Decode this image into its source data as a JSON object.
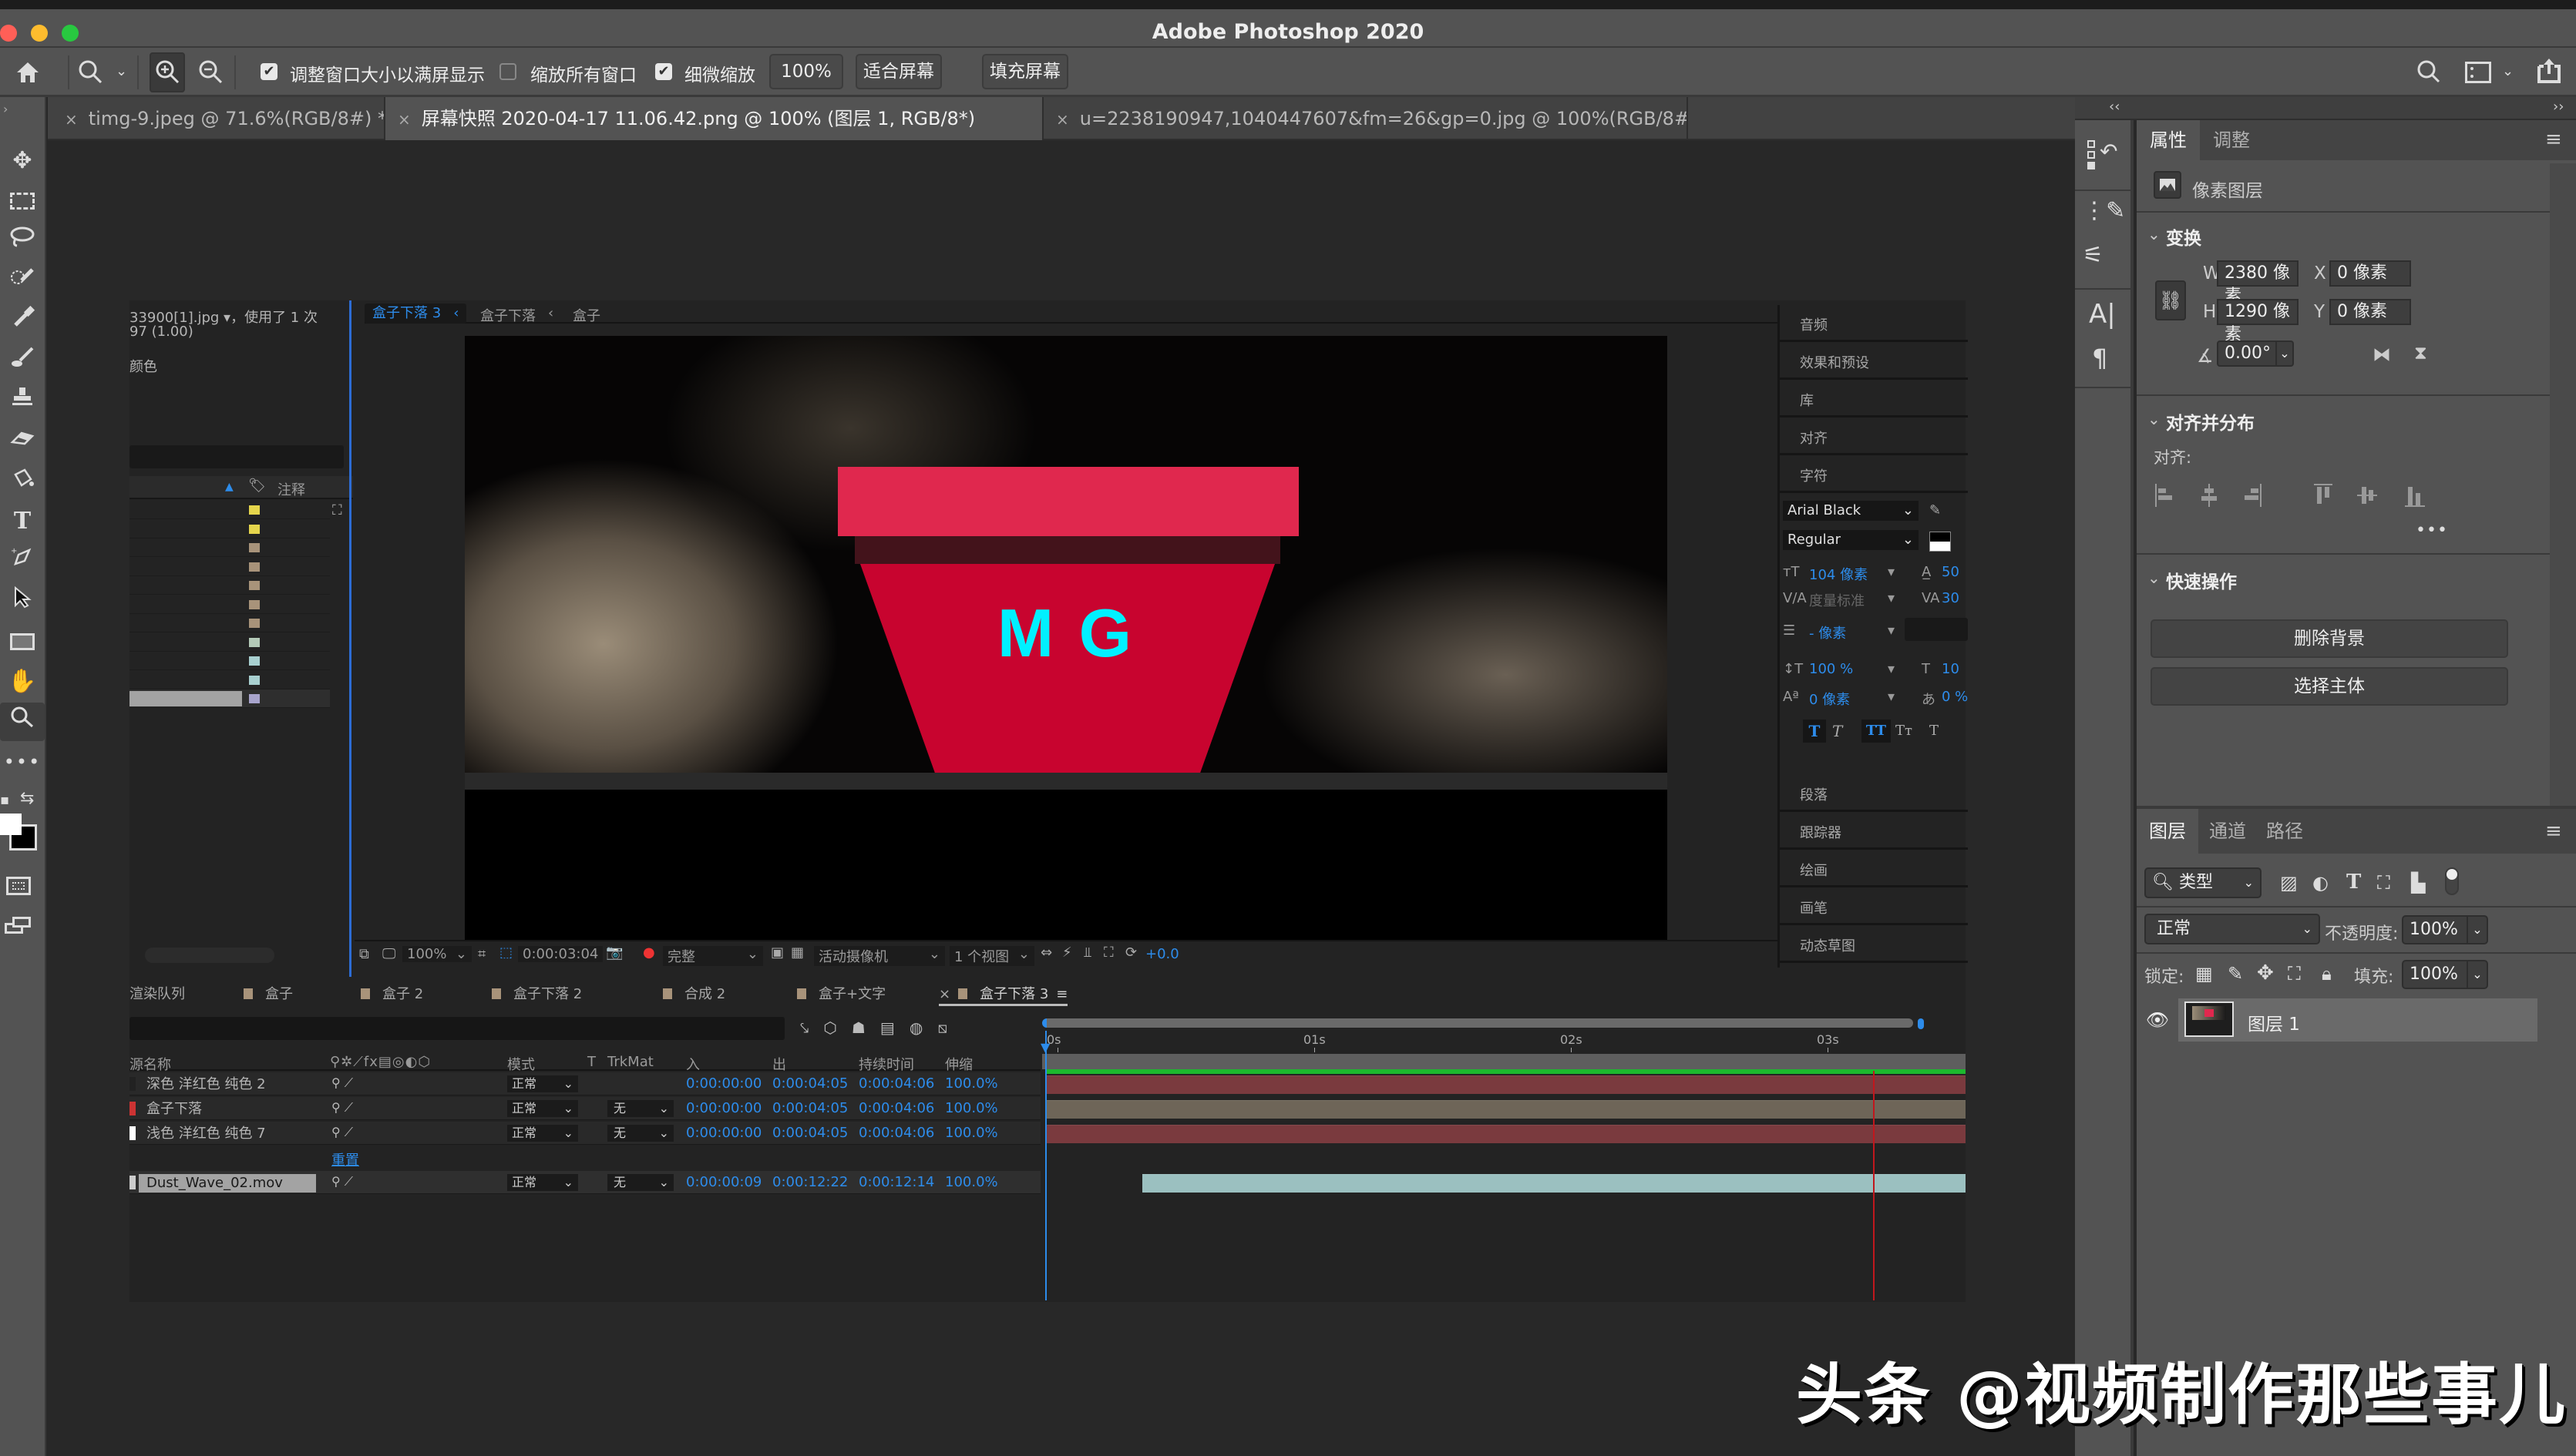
{
  "window": {
    "title": "Adobe Photoshop 2020",
    "traffic_lights": {
      "close": "#ff5f57",
      "minimize": "#febc2e",
      "zoom": "#28c840"
    }
  },
  "options_bar": {
    "home_icon": "home-icon",
    "zoom_tool_icon": "zoom-icon",
    "zoom_in_icon": "zoom-in-icon",
    "zoom_out_icon": "zoom-out-icon",
    "resize_windows_label": "调整窗口大小以满屏显示",
    "resize_windows_checked": true,
    "zoom_all_windows_label": "缩放所有窗口",
    "zoom_all_windows_checked": false,
    "scrubby_zoom_label": "细微缩放",
    "scrubby_zoom_checked": true,
    "zoom_value": "100%",
    "fit_screen_label": "适合屏幕",
    "fill_screen_label": "填充屏幕"
  },
  "document_tabs": [
    {
      "label": "timg-9.jpeg @ 71.6%(RGB/8#) *",
      "active": false
    },
    {
      "label": "屏幕快照 2020-04-17 11.06.42.png @ 100% (图层 1, RGB/8*)",
      "active": true
    },
    {
      "label": "u=2238190947,1040447607&fm=26&gp=0.jpg @ 100%(RGB/8#)",
      "active": false
    }
  ],
  "tools": [
    "move-tool",
    "marquee-tool",
    "lasso-tool",
    "quick-selection-tool",
    "eyedropper-tool",
    "brush-tool",
    "stamp-tool",
    "eraser-tool",
    "paint-bucket-tool",
    "type-tool",
    "pen-tool",
    "path-selection-tool",
    "rectangle-tool",
    "hand-tool",
    "zoom-tool",
    "more-tools"
  ],
  "ae_screenshot": {
    "project_info_line1": "33900[1].jpg ▾，使用了 1 次",
    "project_info_line2": "97 (1.00)",
    "project_info_line3": "颜色",
    "project_column_comment": "注释",
    "project_label_colors": [
      "#e5d54c",
      "#e5d54c",
      "#a8937a",
      "#a8937a",
      "#a8937a",
      "#a8937a",
      "#a8937a",
      "#b4cab8",
      "#a8d0d0",
      "#a8d0d0",
      "#a8a4cc"
    ],
    "breadcrumb": [
      {
        "label": "盒子下落 3",
        "active": true
      },
      {
        "label": "盒子下落",
        "active": false
      },
      {
        "label": "盒子",
        "active": false
      }
    ],
    "comp_text": "M G",
    "comp_colors": {
      "box_lid": "#e0284e",
      "box_shadow": "#43131b",
      "box_body": "#c8042f",
      "text": "#00f0ff"
    },
    "viewer_bar": {
      "zoom": "100%",
      "timecode": "0:00:03:04",
      "resolution": "完整",
      "camera": "活动摄像机",
      "views": "1 个视图",
      "exposure": "+0.0"
    },
    "right_panels_top": [
      "音频",
      "效果和预设",
      "库",
      "对齐",
      "字符"
    ],
    "character": {
      "font": "Arial Black",
      "style": "Regular",
      "size": "104 像素",
      "leading": "50",
      "kerning": "度量标准",
      "tracking": "30",
      "stroke": "- 像素",
      "vscale": "100 %",
      "hscale": "10",
      "baseline": "0 像素",
      "tsume": "0 %"
    },
    "right_panels_bottom": [
      "段落",
      "跟踪器",
      "绘画",
      "画笔",
      "动态草图"
    ],
    "timeline_tabs": [
      {
        "label": "渲染队列",
        "color": null
      },
      {
        "label": "盒子",
        "color": "#a8937a"
      },
      {
        "label": "盒子 2",
        "color": "#a8937a"
      },
      {
        "label": "盒子下落 2",
        "color": "#a8937a"
      },
      {
        "label": "合成 2",
        "color": "#a8937a"
      },
      {
        "label": "盒子+文字",
        "color": "#a8937a"
      },
      {
        "label": "盒子下落 3",
        "color": "#a8937a",
        "active": true
      }
    ],
    "layer_columns": [
      "源名称",
      "模式",
      "T",
      "TrkMat",
      "入",
      "出",
      "持续时间",
      "伸缩"
    ],
    "layers": [
      {
        "name": "深色 洋红色 纯色 2",
        "mode": "正常",
        "trkmat": "",
        "in": "0:00:00:00",
        "out": "0:00:04:05",
        "duration": "0:00:04:06",
        "stretch": "100.0%",
        "bar_color": "#7a3a3e",
        "swatch": "#222"
      },
      {
        "name": "盒子下落",
        "mode": "正常",
        "trkmat": "无",
        "in": "0:00:00:00",
        "out": "0:00:04:05",
        "duration": "0:00:04:06",
        "stretch": "100.0%",
        "bar_color": "#6e6558",
        "swatch": "#c33"
      },
      {
        "name": "浅色 洋红色 纯色 7",
        "mode": "正常",
        "trkmat": "无",
        "in": "0:00:00:00",
        "out": "0:00:04:05",
        "duration": "0:00:04:06",
        "stretch": "100.0%",
        "bar_color": "#7a3a3e",
        "swatch": "#fff"
      },
      {
        "name": "Dust_Wave_02.mov",
        "mode": "正常",
        "trkmat": "无",
        "in": "0:00:00:09",
        "out": "0:00:12:22",
        "duration": "0:00:12:14",
        "stretch": "100.0%",
        "bar_color": "#9bc0c0",
        "swatch": "#ccc",
        "selected": true
      }
    ],
    "reset_label": "重置",
    "ruler_ticks": [
      "0s",
      "01s",
      "02s",
      "03s"
    ],
    "work_area_color": "#1db82e"
  },
  "properties_panel": {
    "tabs": [
      {
        "label": "属性",
        "active": true
      },
      {
        "label": "调整",
        "active": false
      }
    ],
    "layer_kind": "像素图层",
    "transform_title": "变换",
    "w_label": "W",
    "w_value": "2380 像素",
    "h_label": "H",
    "h_value": "1290 像素",
    "x_label": "X",
    "x_value": "0 像素",
    "y_label": "Y",
    "y_value": "0 像素",
    "angle_value": "0.00°",
    "align_title": "对齐并分布",
    "align_label": "对齐:",
    "quick_actions_title": "快速操作",
    "remove_bg_label": "删除背景",
    "select_subject_label": "选择主体"
  },
  "layers_panel": {
    "tabs": [
      {
        "label": "图层",
        "active": true
      },
      {
        "label": "通道",
        "active": false
      },
      {
        "label": "路径",
        "active": false
      }
    ],
    "filter_kind": "类型",
    "blend_mode": "正常",
    "opacity_label": "不透明度:",
    "opacity_value": "100%",
    "lock_label": "锁定:",
    "fill_label": "填充:",
    "fill_value": "100%",
    "layers": [
      {
        "name": "图层 1",
        "visible": true,
        "selected": true
      }
    ]
  },
  "watermark": "头条 @视频制作那些事儿"
}
